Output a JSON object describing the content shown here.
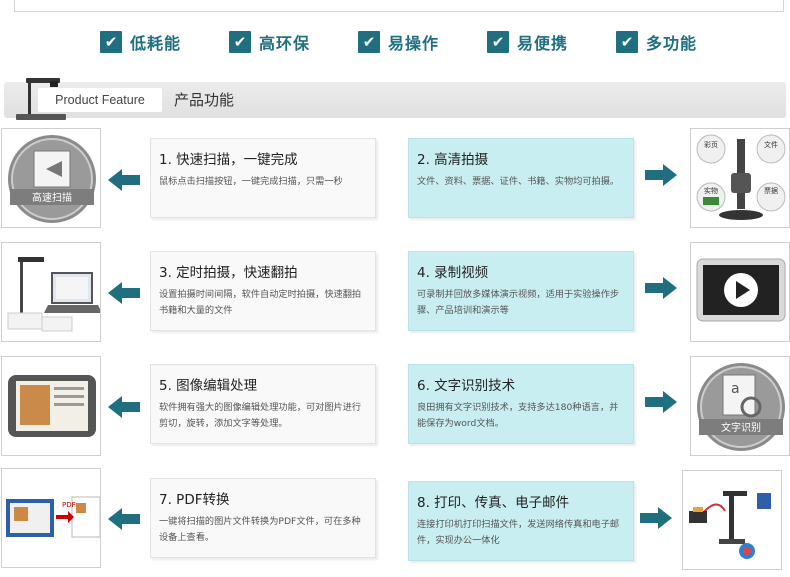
{
  "features": [
    {
      "label": "低耗能",
      "check": "✔"
    },
    {
      "label": "高环保",
      "check": "✔"
    },
    {
      "label": "易操作",
      "check": "✔"
    },
    {
      "label": "易便携",
      "check": "✔"
    },
    {
      "label": "多功能",
      "check": "✔"
    }
  ],
  "header": {
    "english": "Product Feature",
    "title": "产品功能"
  },
  "cards": [
    {
      "title": "1. 快速扫描，一键完成",
      "desc": "鼠标点击扫描按钮，一键完成扫描，只需一秒"
    },
    {
      "title": "2. 高清拍摄",
      "desc": "文件、资料、票据、证件、书籍、实物均可拍摄。"
    },
    {
      "title": "3. 定时拍摄，快速翻拍",
      "desc": "设置拍摄时间间隔，软件自动定时拍摄，快速翻拍书籍和大量的文件"
    },
    {
      "title": "4. 录制视频",
      "desc": "可录制并回放多媒体演示视频，适用于实验操作步骤、产品培训和演示等"
    },
    {
      "title": "5. 图像编辑处理",
      "desc": "软件拥有强大的图像编辑处理功能，可对图片进行剪切，旋转，添加文字等处理。"
    },
    {
      "title": "6. 文字识别技术",
      "desc": "良田拥有文字识别技术，支持多达180种语言，并能保存为word文档。"
    },
    {
      "title": "7. PDF转换",
      "desc": "一键将扫描的图片文件转换为PDF文件，可在多种设备上查看。"
    },
    {
      "title": "8. 打印、传真、电子邮件",
      "desc": "连接打印机打印扫描文件，发送网络传真和电子邮件，实现办公一体化"
    }
  ],
  "thumbs": {
    "fast_scan_label": "高速扫描",
    "hd_labels": {
      "photo": "彩页",
      "file": "文件",
      "object": "实物",
      "ticket": "票据"
    },
    "ocr_label": "文字识别",
    "ocr_glyph": "a",
    "pdf_label": "PDF"
  },
  "colors": {
    "accent": "#1f6f80",
    "blue_card": "#c9eef2",
    "arrow": "#1f6f80"
  }
}
